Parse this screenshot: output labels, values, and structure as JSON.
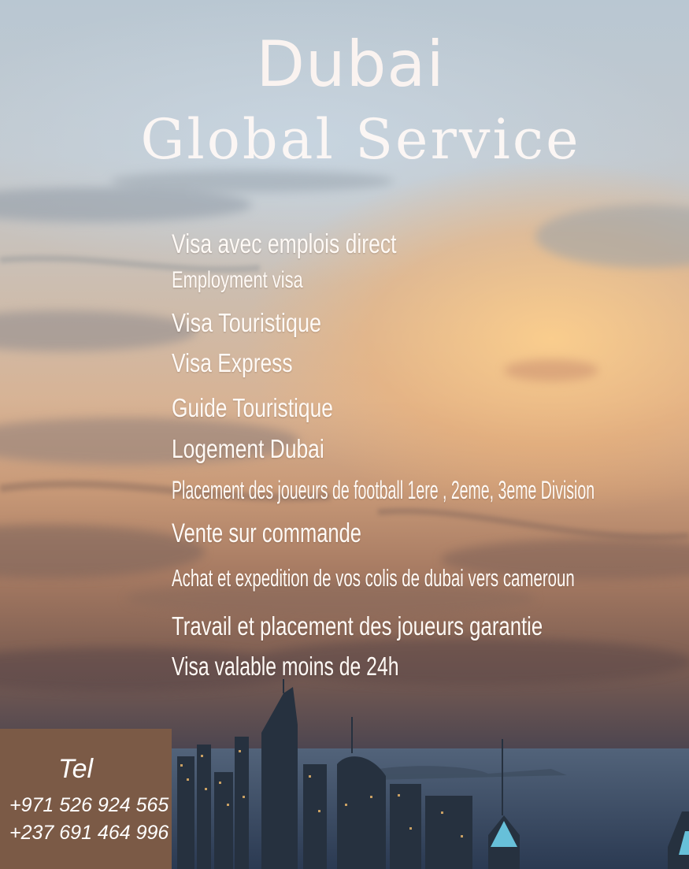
{
  "header": {
    "title_line1": "Dubai",
    "title_line2": "Global Service"
  },
  "services": [
    "Visa avec emplois direct",
    "Employment visa",
    "Visa Touristique",
    "Visa Express",
    "Guide Touristique",
    "Logement Dubai",
    "Placement des joueurs de football 1ere , 2eme, 3eme Division",
    "Vente sur commande",
    "Achat et expedition de vos colis de dubai vers cameroun",
    "Travail et placement des joueurs garantie",
    "Visa valable moins de 24h"
  ],
  "contact": {
    "label": "Tel",
    "phones": [
      "+971 526 924 565",
      "+237 691 464 996"
    ]
  },
  "colors": {
    "text": "#fffaf6",
    "tel_box": "#7b5a46"
  }
}
